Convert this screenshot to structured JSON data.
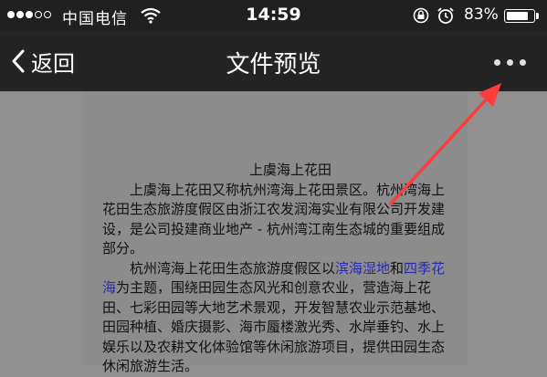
{
  "status_bar": {
    "carrier": "中国电信",
    "time": "14:59",
    "battery_percent": "83%",
    "battery_level": 0.83,
    "signal_bars_filled": 3,
    "signal_bars_total": 5
  },
  "nav": {
    "back_label": "返回",
    "title": "文件预览",
    "more_icon": "ellipsis-icon"
  },
  "document": {
    "title": "上虞海上花田",
    "para1": "上虞海上花田又称杭州湾海上花田景区。杭州湾海上花田生态旅游度假区由浙江农发润海实业有限公司开发建设，是公司投建商业地产 - 杭州湾江南生态城的重要组成部分。",
    "para2_before": "杭州湾海上花田生态旅游度假区以",
    "link1": "滨海湿地",
    "para2_and": "和",
    "link2": "四季花海",
    "para2_after": "为主题，围绕田园生态风光和创意农业，营造海上花田、七彩田园等大地艺术景观，开发智慧农业示范基地、田园种植、婚庆摄影、海市蜃楼激光秀、水岸垂钓、水上娱乐以及农耕文化体验馆等休闲旅游项目，提供田园生态休闲旅游生活。"
  },
  "colors": {
    "status_bg": "#202020",
    "nav_bg": "#242424",
    "doc_bg": "#8f8f8f",
    "link": "#2a2ab0",
    "arrow": "#ff3b3b"
  }
}
